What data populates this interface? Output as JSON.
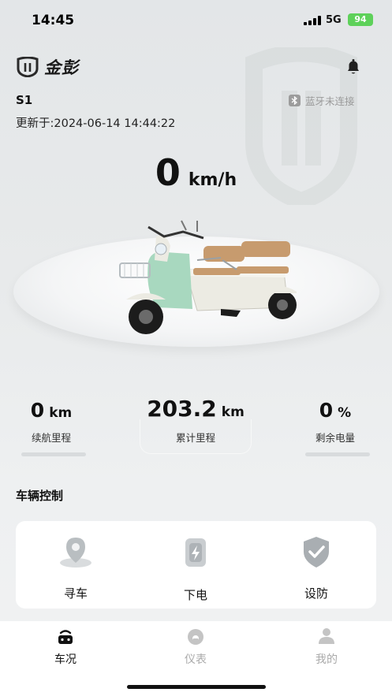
{
  "status_bar": {
    "time": "14:45",
    "network": "5G",
    "battery": "94"
  },
  "header": {
    "brand": "金彭",
    "vehicle_name": "S1",
    "bluetooth_status": "蓝牙未连接",
    "updated_at": "更新于:2024-06-14 14:44:22"
  },
  "speed": {
    "value": "0",
    "unit": "km/h"
  },
  "stats": [
    {
      "value": "0",
      "unit": "km",
      "label": "续航里程"
    },
    {
      "value": "203.2",
      "unit": "km",
      "label": "累计里程"
    },
    {
      "value": "0",
      "unit": "%",
      "label": "剩余电量"
    }
  ],
  "controls": {
    "title": "车辆控制",
    "items": [
      {
        "label": "寻车",
        "icon": "location-pin-icon"
      },
      {
        "label": "下电",
        "icon": "power-off-icon"
      },
      {
        "label": "设防",
        "icon": "shield-check-icon"
      }
    ]
  },
  "bottom_nav": [
    {
      "label": "车况",
      "icon": "vehicle-status-icon",
      "active": true
    },
    {
      "label": "仪表",
      "icon": "dashboard-gauge-icon",
      "active": false
    },
    {
      "label": "我的",
      "icon": "profile-icon",
      "active": false
    }
  ],
  "colors": {
    "active_tab": "#111111",
    "inactive_tab": "#aaaaaa",
    "battery_green": "#5ed15a",
    "vehicle_mint": "#a8d8bf",
    "seat_tan": "#c79b6e"
  }
}
